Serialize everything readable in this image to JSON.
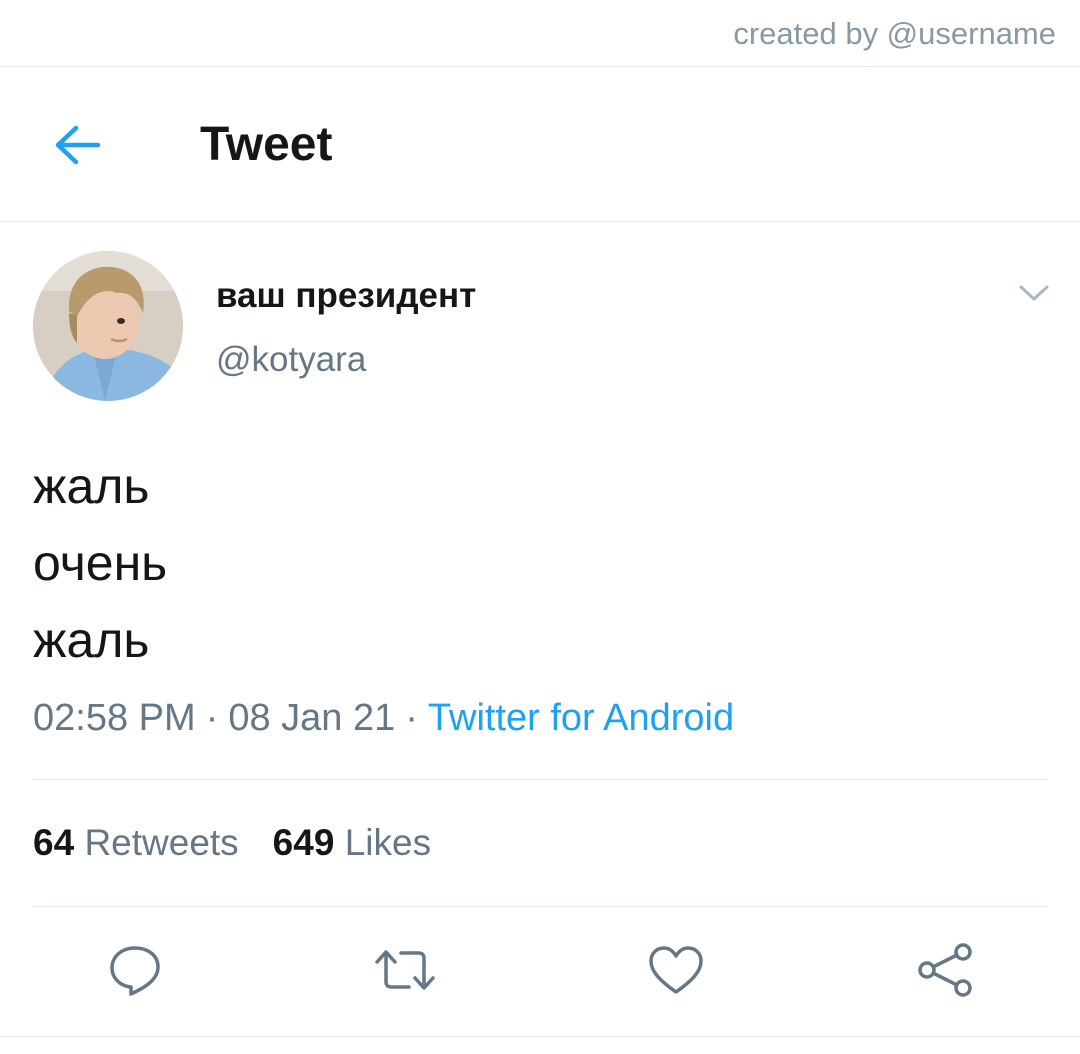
{
  "credit": {
    "text": "created by @username"
  },
  "header": {
    "title": "Tweet",
    "back_icon": "arrow-left-icon"
  },
  "tweet": {
    "author": {
      "display_name": "ваш президент",
      "handle": "@kotyara"
    },
    "menu_icon": "chevron-down-icon",
    "text_lines": [
      "жаль",
      "очень",
      "жаль"
    ],
    "meta": {
      "time": "02:58 PM",
      "date": "08 Jan 21",
      "separator": "·",
      "source": "Twitter for Android"
    },
    "stats": {
      "retweets_count": "64",
      "retweets_label": "Retweets",
      "likes_count": "649",
      "likes_label": "Likes"
    },
    "actions": [
      "reply-icon",
      "retweet-icon",
      "like-icon",
      "share-icon"
    ]
  },
  "colors": {
    "accent": "#1da1f2",
    "text_primary": "#14171a",
    "text_secondary": "#657786",
    "icon_gray": "#657786",
    "divider": "#e1e8ed"
  }
}
